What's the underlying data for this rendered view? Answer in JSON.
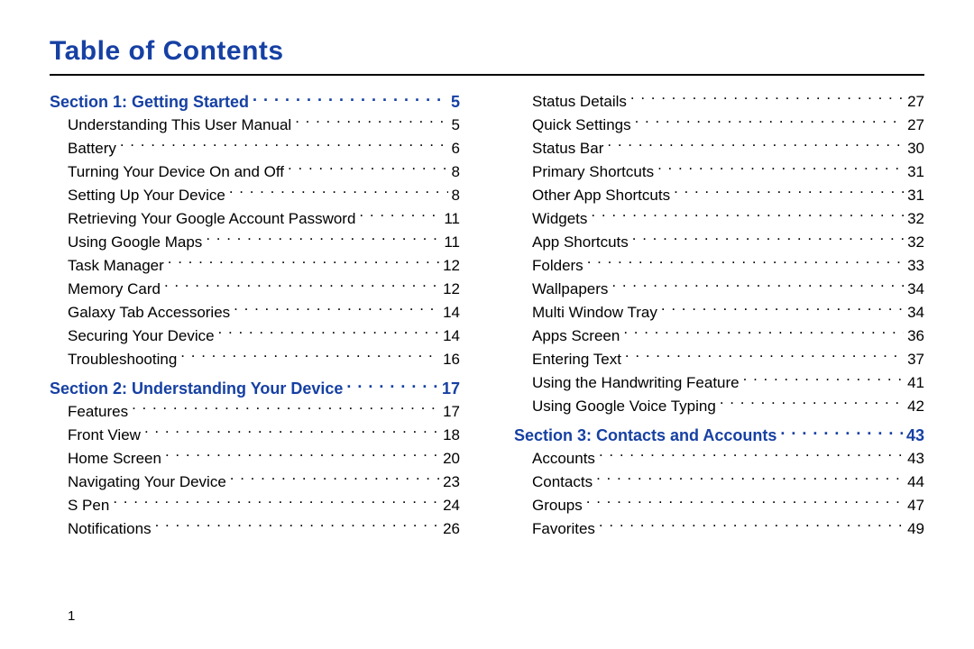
{
  "title": "Table of Contents",
  "page_number": "1",
  "columns": [
    [
      {
        "type": "section",
        "label": "Section 1:  Getting Started",
        "page": "5"
      },
      {
        "type": "entry",
        "label": "Understanding This User Manual",
        "page": "5"
      },
      {
        "type": "entry",
        "label": "Battery",
        "page": "6"
      },
      {
        "type": "entry",
        "label": "Turning Your Device On and Off",
        "page": "8"
      },
      {
        "type": "entry",
        "label": "Setting Up Your Device",
        "page": "8"
      },
      {
        "type": "entry",
        "label": "Retrieving Your Google Account Password",
        "page": "11"
      },
      {
        "type": "entry",
        "label": "Using Google Maps",
        "page": "11"
      },
      {
        "type": "entry",
        "label": "Task Manager",
        "page": "12"
      },
      {
        "type": "entry",
        "label": "Memory Card",
        "page": "12"
      },
      {
        "type": "entry",
        "label": "Galaxy Tab Accessories",
        "page": "14"
      },
      {
        "type": "entry",
        "label": "Securing Your Device",
        "page": "14"
      },
      {
        "type": "entry",
        "label": "Troubleshooting",
        "page": "16"
      },
      {
        "type": "section",
        "label": "Section 2:  Understanding Your Device",
        "page": "17"
      },
      {
        "type": "entry",
        "label": "Features",
        "page": "17"
      },
      {
        "type": "entry",
        "label": "Front View",
        "page": "18"
      },
      {
        "type": "entry",
        "label": "Home Screen",
        "page": "20"
      },
      {
        "type": "entry",
        "label": "Navigating Your Device",
        "page": "23"
      },
      {
        "type": "entry",
        "label": "S Pen",
        "page": "24"
      },
      {
        "type": "entry",
        "label": "Notifications",
        "page": "26"
      }
    ],
    [
      {
        "type": "entry",
        "label": "Status Details",
        "page": "27"
      },
      {
        "type": "entry",
        "label": "Quick Settings",
        "page": "27"
      },
      {
        "type": "entry",
        "label": "Status Bar",
        "page": "30"
      },
      {
        "type": "entry",
        "label": "Primary Shortcuts",
        "page": "31"
      },
      {
        "type": "entry",
        "label": "Other App Shortcuts",
        "page": "31"
      },
      {
        "type": "entry",
        "label": "Widgets",
        "page": "32"
      },
      {
        "type": "entry",
        "label": "App Shortcuts",
        "page": "32"
      },
      {
        "type": "entry",
        "label": "Folders",
        "page": "33"
      },
      {
        "type": "entry",
        "label": "Wallpapers",
        "page": "34"
      },
      {
        "type": "entry",
        "label": "Multi Window Tray",
        "page": "34"
      },
      {
        "type": "entry",
        "label": "Apps Screen",
        "page": "36"
      },
      {
        "type": "entry",
        "label": "Entering Text",
        "page": "37"
      },
      {
        "type": "entry",
        "label": "Using the Handwriting Feature",
        "page": "41"
      },
      {
        "type": "entry",
        "label": "Using Google Voice Typing",
        "page": "42"
      },
      {
        "type": "section",
        "label": "Section 3:  Contacts and Accounts",
        "page": "43"
      },
      {
        "type": "entry",
        "label": "Accounts",
        "page": "43"
      },
      {
        "type": "entry",
        "label": "Contacts",
        "page": "44"
      },
      {
        "type": "entry",
        "label": "Groups",
        "page": "47"
      },
      {
        "type": "entry",
        "label": "Favorites",
        "page": "49"
      }
    ]
  ]
}
